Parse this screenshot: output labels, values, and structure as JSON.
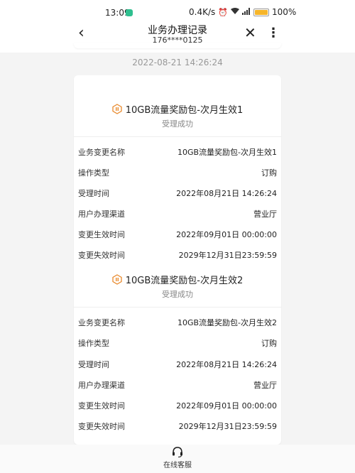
{
  "status_bar": {
    "time": "13:09",
    "network_speed": "0.4K/s",
    "battery": "100%",
    "battery_level": 1.0,
    "icons": [
      "alarm-icon",
      "wifi-icon",
      "signal-icon",
      "battery-icon"
    ]
  },
  "header": {
    "title": "业务办理记录",
    "subtitle": "176****0125",
    "back_icon": "chevron-left-icon",
    "close_icon": "close-icon",
    "more_icon": "more-vertical-icon"
  },
  "date": "2022-08-21 14:26:24",
  "records": [
    {
      "name": "10GB流量奖励包-次月生效1",
      "status": "受理成功",
      "fields": [
        {
          "label": "业务变更名称",
          "value": "10GB流量奖励包-次月生效1"
        },
        {
          "label": "操作类型",
          "value": "订购"
        },
        {
          "label": "受理时间",
          "value": "2022年08月21日 14:26:24"
        },
        {
          "label": "用户办理渠道",
          "value": "营业厅"
        },
        {
          "label": "变更生效时间",
          "value": "2022年09月01日 00:00:00"
        },
        {
          "label": "变更失效时间",
          "value": "2029年12月31日23:59:59"
        }
      ]
    },
    {
      "name": "10GB流量奖励包-次月生效2",
      "status": "受理成功",
      "fields": [
        {
          "label": "业务变更名称",
          "value": "10GB流量奖励包-次月生效2"
        },
        {
          "label": "操作类型",
          "value": "订购"
        },
        {
          "label": "受理时间",
          "value": "2022年08月21日 14:26:24"
        },
        {
          "label": "用户办理渠道",
          "value": "营业厅"
        },
        {
          "label": "变更生效时间",
          "value": "2022年09月01日 00:00:00"
        },
        {
          "label": "变更失效时间",
          "value": "2029年12月31日23:59:59"
        }
      ]
    }
  ],
  "bottom_bar": {
    "label": "在线客服",
    "icon": "headset-icon"
  },
  "colors": {
    "accent_icon": "#e98a2d",
    "app_badge": "#2fbf8f",
    "battery": "#f6b52a"
  }
}
